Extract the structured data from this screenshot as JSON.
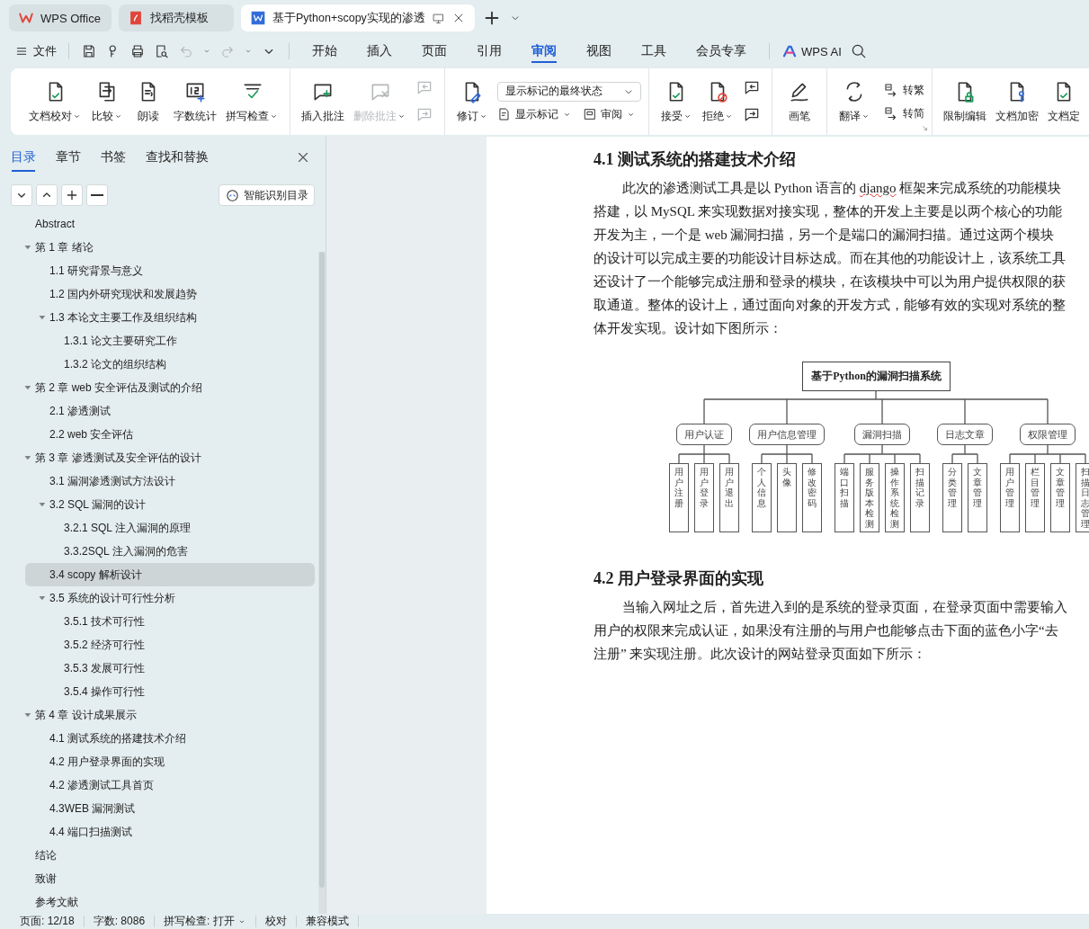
{
  "tabs": [
    {
      "label": "WPS Office",
      "selected": false
    },
    {
      "label": "找稻壳模板",
      "selected": false
    },
    {
      "label": "基于Python+scopy实现的渗透",
      "selected": true
    }
  ],
  "menu_bar": {
    "file_menu": "文件",
    "ai_button": "WPS AI",
    "tabs": [
      {
        "label": "开始",
        "selected": false
      },
      {
        "label": "插入",
        "selected": false
      },
      {
        "label": "页面",
        "selected": false
      },
      {
        "label": "引用",
        "selected": false
      },
      {
        "label": "审阅",
        "selected": true
      },
      {
        "label": "视图",
        "selected": false
      },
      {
        "label": "工具",
        "selected": false
      },
      {
        "label": "会员专享",
        "selected": false
      }
    ]
  },
  "ribbon": {
    "groups": [
      {
        "launcher": false,
        "items": [
          {
            "kind": "large",
            "label": "文档校对",
            "dropdown": true,
            "disabled": false
          },
          {
            "kind": "large",
            "label": "比较",
            "dropdown": true,
            "disabled": false
          },
          {
            "kind": "large",
            "label": "朗读",
            "dropdown": false,
            "disabled": false
          },
          {
            "kind": "large",
            "label": "字数统计",
            "dropdown": false,
            "disabled": false
          },
          {
            "kind": "large",
            "label": "拼写检查",
            "dropdown": true,
            "disabled": false
          }
        ]
      },
      {
        "launcher": false,
        "items": [
          {
            "kind": "large",
            "label": "插入批注",
            "dropdown": false,
            "disabled": false
          },
          {
            "kind": "large",
            "label": "删除批注",
            "dropdown": true,
            "disabled": true
          },
          {
            "kind": "icon_pair",
            "disabled": true
          }
        ]
      },
      {
        "launcher": false,
        "items": [
          {
            "kind": "large",
            "label": "修订",
            "dropdown": true,
            "disabled": false
          },
          {
            "kind": "markup",
            "select": "显示标记的最终状态",
            "buttons": [
              {
                "label": "显示标记",
                "dropdown": true
              },
              {
                "label": "审阅",
                "dropdown": true
              }
            ]
          }
        ]
      },
      {
        "launcher": false,
        "items": [
          {
            "kind": "large",
            "label": "接受",
            "dropdown": true,
            "disabled": false
          },
          {
            "kind": "large",
            "label": "拒绝",
            "dropdown": true,
            "disabled": false
          },
          {
            "kind": "icon_pair",
            "disabled": false
          }
        ]
      },
      {
        "launcher": false,
        "items": [
          {
            "kind": "large",
            "label": "画笔",
            "dropdown": false,
            "disabled": false
          }
        ]
      },
      {
        "launcher": true,
        "items": [
          {
            "kind": "large",
            "label": "翻译",
            "dropdown": true,
            "disabled": false
          },
          {
            "kind": "stack",
            "buttons": [
              {
                "label": "转繁"
              },
              {
                "label": "转简"
              }
            ]
          }
        ]
      },
      {
        "launcher": false,
        "items": [
          {
            "kind": "large",
            "label": "限制编辑",
            "dropdown": false,
            "disabled": false
          },
          {
            "kind": "large",
            "label": "文档加密",
            "dropdown": false,
            "disabled": false
          },
          {
            "kind": "large",
            "label": "文档定",
            "dropdown": false,
            "disabled": false
          }
        ]
      }
    ]
  },
  "panel": {
    "tabs": [
      {
        "label": "目录",
        "selected": true
      },
      {
        "label": "章节",
        "selected": false
      },
      {
        "label": "书签",
        "selected": false
      },
      {
        "label": "查找和替换",
        "selected": false
      }
    ],
    "smart_button": "智能识别目录",
    "tree": [
      {
        "label": "Abstract",
        "selected": false
      },
      {
        "label": "第 1 章  绪论",
        "selected": false,
        "expanded": true,
        "children": [
          {
            "label": "1.1  研究背景与意义",
            "selected": false
          },
          {
            "label": "1.2  国内外研究现状和发展趋势",
            "selected": false
          },
          {
            "label": "1.3  本论文主要工作及组织结构",
            "selected": false,
            "expanded": true,
            "children": [
              {
                "label": "1.3.1  论文主要研究工作",
                "selected": false
              },
              {
                "label": "1.3.2  论文的组织结构",
                "selected": false
              }
            ]
          }
        ]
      },
      {
        "label": "第 2 章  web 安全评估及测试的介绍",
        "selected": false,
        "expanded": true,
        "children": [
          {
            "label": "2.1  渗透测试",
            "selected": false
          },
          {
            "label": "2.2 web 安全评估",
            "selected": false
          }
        ]
      },
      {
        "label": "第 3 章  渗透测试及安全评估的设计",
        "selected": false,
        "expanded": true,
        "children": [
          {
            "label": "3.1  漏洞渗透测试方法设计",
            "selected": false
          },
          {
            "label": "3.2 SQL 漏洞的设计",
            "selected": false,
            "expanded": true,
            "children": [
              {
                "label": "3.2.1 SQL 注入漏洞的原理",
                "selected": false
              },
              {
                "label": "3.3.2SQL 注入漏洞的危害",
                "selected": false
              }
            ]
          },
          {
            "label": "3.4 scopy 解析设计",
            "selected": true
          },
          {
            "label": "3.5 系统的设计可行性分析",
            "selected": false,
            "expanded": true,
            "children": [
              {
                "label": "3.5.1 技术可行性",
                "selected": false
              },
              {
                "label": "3.5.2 经济可行性",
                "selected": false
              },
              {
                "label": "3.5.3 发展可行性",
                "selected": false
              },
              {
                "label": "3.5.4 操作可行性",
                "selected": false
              }
            ]
          }
        ]
      },
      {
        "label": "第 4 章  设计成果展示",
        "selected": false,
        "expanded": true,
        "children": [
          {
            "label": "4.1  测试系统的搭建技术介绍",
            "selected": false
          },
          {
            "label": "4.2 用户登录界面的实现",
            "selected": false
          },
          {
            "label": "4.2 渗透测试工具首页",
            "selected": false
          },
          {
            "label": "4.3WEB 漏洞测试",
            "selected": false
          },
          {
            "label": "4.4 端口扫描测试",
            "selected": false
          }
        ]
      },
      {
        "label": "结论",
        "selected": false
      },
      {
        "label": "致谢",
        "selected": false
      },
      {
        "label": "参考文献",
        "selected": false
      }
    ]
  },
  "document": {
    "sections": [
      {
        "heading": "4.1  测试系统的搭建技术介绍",
        "blocks": [
          {
            "kind": "paragraph",
            "lines": [
              [
                {
                  "text": "此次的渗透测试工具是以 Python 语言的 ",
                  "misspelled": false
                },
                {
                  "text": "django",
                  "misspelled": true
                },
                {
                  "text": " 框架来完成系统的功能模块",
                  "misspelled": false
                }
              ],
              [
                {
                  "text": "搭建，以 MySQL 来实现数据对接实现，整体的开发上主要是以两个核心的功能",
                  "misspelled": false
                }
              ],
              [
                {
                  "text": "开发为主，一个是 web 漏洞扫描，另一个是端口的漏洞扫描。通过这两个模块",
                  "misspelled": false
                }
              ],
              [
                {
                  "text": "的设计可以完成主要的功能设计目标达成。而在其他的功能设计上，该系统工具",
                  "misspelled": false
                }
              ],
              [
                {
                  "text": "还设计了一个能够完成注册和登录的模块，在该模块中可以为用户提供权限的获",
                  "misspelled": false
                }
              ],
              [
                {
                  "text": "取通道。整体的设计上，通过面向对象的开发方式，能够有效的实现对系统的整",
                  "misspelled": false
                }
              ],
              [
                {
                  "text": "体开发实现。设计如下图所示：",
                  "misspelled": false
                }
              ]
            ]
          },
          {
            "kind": "diagram",
            "title": "基于Python的漏洞扫描系统",
            "branches": [
              {
                "label": "用户认证",
                "leaves": [
                  "用户注册",
                  "用户登录",
                  "用户退出"
                ]
              },
              {
                "label": "用户信息管理",
                "leaves": [
                  "个人信息",
                  "头像",
                  "修改密码"
                ]
              },
              {
                "label": "漏洞扫描",
                "leaves": [
                  "端口扫描",
                  "服务版本检测",
                  "操作系统检测",
                  "扫描记录"
                ]
              },
              {
                "label": "日志文章",
                "leaves": [
                  "分类管理",
                  "文章管理"
                ]
              },
              {
                "label": "权限管理",
                "leaves": [
                  "用户管理",
                  "栏目管理",
                  "文章管理",
                  "扫描日志管理"
                ]
              }
            ]
          }
        ]
      },
      {
        "heading": "4.2 用户登录界面的实现",
        "blocks": [
          {
            "kind": "paragraph",
            "lines": [
              [
                {
                  "text": "当输入网址之后，首先进入到的是系统的登录页面，在登录页面中需要输入",
                  "misspelled": false
                }
              ],
              [
                {
                  "text": "用户的权限来完成认证，如果没有注册的与用户也能够点击下面的蓝色小字“去",
                  "misspelled": false
                }
              ],
              [
                {
                  "text": "注册” 来实现注册。此次设计的网站登录页面如下所示：",
                  "misspelled": false
                }
              ]
            ]
          }
        ]
      }
    ]
  },
  "status_bar": {
    "items": [
      {
        "label": "页面: 12/18",
        "dropdown": false
      },
      {
        "label": "字数: 8086",
        "dropdown": false
      },
      {
        "label": "拼写检查: 打开",
        "dropdown": true
      },
      {
        "label": "校对",
        "dropdown": false
      },
      {
        "label": "兼容模式",
        "dropdown": false
      }
    ]
  }
}
